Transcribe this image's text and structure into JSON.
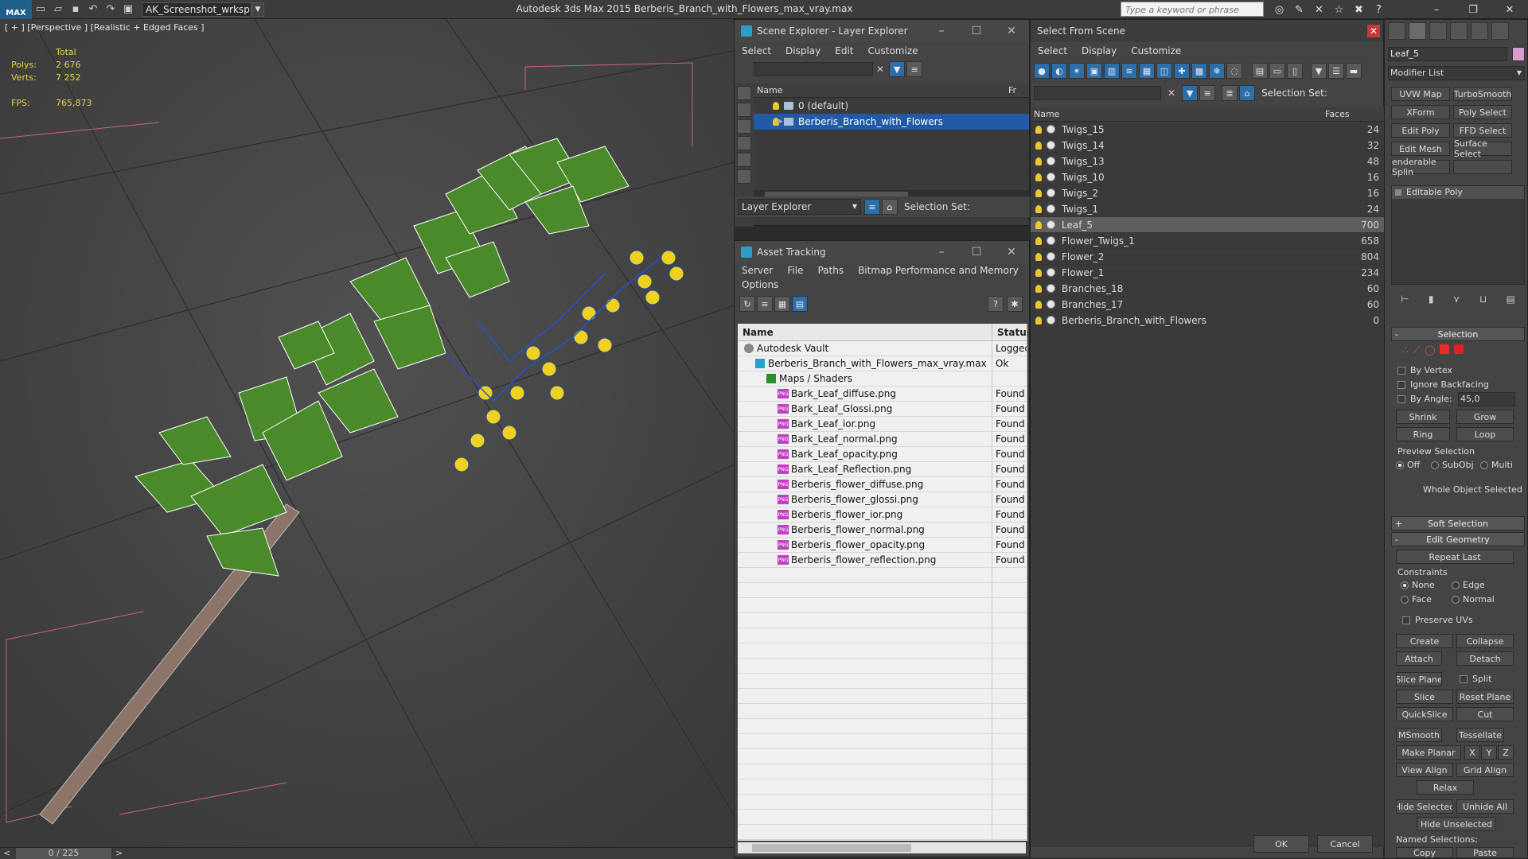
{
  "app": {
    "logo": "MAX",
    "workspace": "AK_Screenshot_wrksp",
    "title": "Autodesk 3ds Max  2015    Berberis_Branch_with_Flowers_max_vray.max",
    "search_placeholder": "Type a keyword or phrase"
  },
  "viewport": {
    "label": "[ + ] [Perspective ] [Realistic + Edged Faces ]",
    "stats": {
      "total_label": "Total",
      "polys_label": "Polys:",
      "polys_value": "2 676",
      "verts_label": "Verts:",
      "verts_value": "7 252",
      "fps_label": "FPS:",
      "fps_value": "765,873"
    },
    "timeline": {
      "counter": "0 / 225",
      "prev": "<",
      "next": ">"
    }
  },
  "scene_explorer": {
    "title": "Scene Explorer - Layer Explorer",
    "menu": [
      "Select",
      "Display",
      "Edit",
      "Customize"
    ],
    "col_name": "Name",
    "col_fr": "Fr",
    "layers": [
      {
        "name": "0 (default)",
        "selected": false
      },
      {
        "name": "Berberis_Branch_with_Flowers",
        "selected": true
      }
    ],
    "footer_dropdown": "Layer Explorer",
    "selection_set_label": "Selection Set:"
  },
  "asset_tracking": {
    "title": "Asset Tracking",
    "menu": [
      "Server",
      "File",
      "Paths",
      "Bitmap Performance and Memory"
    ],
    "menu2": "Options",
    "col_name": "Name",
    "col_status": "Status",
    "rows": [
      {
        "name": "Autodesk Vault",
        "status": "Logged",
        "indent": 0,
        "icon": "vault"
      },
      {
        "name": "Berberis_Branch_with_Flowers_max_vray.max",
        "status": "Ok",
        "indent": 1,
        "icon": "max"
      },
      {
        "name": "Maps / Shaders",
        "status": "",
        "indent": 2,
        "icon": "maps"
      },
      {
        "name": "Bark_Leaf_diffuse.png",
        "status": "Found",
        "indent": 3,
        "icon": "png"
      },
      {
        "name": "Bark_Leaf_Glossi.png",
        "status": "Found",
        "indent": 3,
        "icon": "png"
      },
      {
        "name": "Bark_Leaf_ior.png",
        "status": "Found",
        "indent": 3,
        "icon": "png"
      },
      {
        "name": "Bark_Leaf_normal.png",
        "status": "Found",
        "indent": 3,
        "icon": "png"
      },
      {
        "name": "Bark_Leaf_opacity.png",
        "status": "Found",
        "indent": 3,
        "icon": "png"
      },
      {
        "name": "Bark_Leaf_Reflection.png",
        "status": "Found",
        "indent": 3,
        "icon": "png"
      },
      {
        "name": "Berberis_flower_diffuse.png",
        "status": "Found",
        "indent": 3,
        "icon": "png"
      },
      {
        "name": "Berberis_flower_glossi.png",
        "status": "Found",
        "indent": 3,
        "icon": "png"
      },
      {
        "name": "Berberis_flower_ior.png",
        "status": "Found",
        "indent": 3,
        "icon": "png"
      },
      {
        "name": "Berberis_flower_normal.png",
        "status": "Found",
        "indent": 3,
        "icon": "png"
      },
      {
        "name": "Berberis_flower_opacity.png",
        "status": "Found",
        "indent": 3,
        "icon": "png"
      },
      {
        "name": "Berberis_flower_reflection.png",
        "status": "Found",
        "indent": 3,
        "icon": "png"
      }
    ],
    "png_badge": "PNG"
  },
  "select_from_scene": {
    "title": "Select From Scene",
    "menu": [
      "Select",
      "Display",
      "Customize"
    ],
    "selection_set_label": "Selection Set:",
    "col_name": "Name",
    "col_faces": "Faces",
    "objects": [
      {
        "name": "Twigs_15",
        "faces": "24"
      },
      {
        "name": "Twigs_14",
        "faces": "32"
      },
      {
        "name": "Twigs_13",
        "faces": "48"
      },
      {
        "name": "Twigs_10",
        "faces": "16"
      },
      {
        "name": "Twigs_2",
        "faces": "16"
      },
      {
        "name": "Twigs_1",
        "faces": "24"
      },
      {
        "name": "Leaf_5",
        "faces": "700",
        "selected": true
      },
      {
        "name": "Flower_Twigs_1",
        "faces": "658"
      },
      {
        "name": "Flower_2",
        "faces": "804"
      },
      {
        "name": "Flower_1",
        "faces": "234"
      },
      {
        "name": "Branches_18",
        "faces": "60"
      },
      {
        "name": "Branches_17",
        "faces": "60"
      },
      {
        "name": "Berberis_Branch_with_Flowers",
        "faces": "0"
      }
    ],
    "ok": "OK",
    "cancel": "Cancel"
  },
  "command_panel": {
    "object_name": "Leaf_5",
    "modifier_list": "Modifier List",
    "modifier_buttons": [
      "UVW Map",
      "TurboSmooth",
      "XForm",
      "Poly Select",
      "Edit Poly",
      "FFD Select",
      "Edit Mesh",
      "Surface Select",
      "enderable Splin",
      ""
    ],
    "stack_item": "Editable Poly",
    "selection": {
      "header": "Selection",
      "by_vertex": "By Vertex",
      "ignore_backfacing": "Ignore Backfacing",
      "by_angle": "By Angle:",
      "angle_value": "45,0",
      "shrink": "Shrink",
      "grow": "Grow",
      "ring": "Ring",
      "loop": "Loop",
      "preview_selection": "Preview Selection",
      "preview_off": "Off",
      "preview_subobj": "SubObj",
      "preview_multi": "Multi",
      "status": "Whole Object Selected"
    },
    "soft_selection": "Soft Selection",
    "edit_geometry": {
      "header": "Edit Geometry",
      "repeat_last": "Repeat Last",
      "constraints": "Constraints",
      "none": "None",
      "edge": "Edge",
      "face": "Face",
      "normal": "Normal",
      "preserve_uvs": "Preserve UVs",
      "create": "Create",
      "collapse": "Collapse",
      "attach": "Attach",
      "detach": "Detach",
      "slice_plane": "Slice Plane",
      "split": "Split",
      "slice": "Slice",
      "reset_plane": "Reset Plane",
      "quickslice": "QuickSlice",
      "cut": "Cut",
      "msmooth": "MSmooth",
      "tessellate": "Tessellate",
      "make_planar": "Make Planar",
      "x": "X",
      "y": "Y",
      "z": "Z",
      "view_align": "View Align",
      "grid_align": "Grid Align",
      "relax": "Relax",
      "hide_selected": "Hide Selected",
      "unhide_all": "Unhide All",
      "hide_unselected": "Hide Unselected",
      "named_selections": "Named Selections:",
      "copy": "Copy",
      "paste": "Paste"
    }
  },
  "colors": {
    "selection_blue": "#215aa6",
    "stats_yellow": "#e6d14c",
    "leaf_green": "#4a8a2a",
    "flower_yellow": "#f0d020",
    "close_red": "#c8373a"
  }
}
